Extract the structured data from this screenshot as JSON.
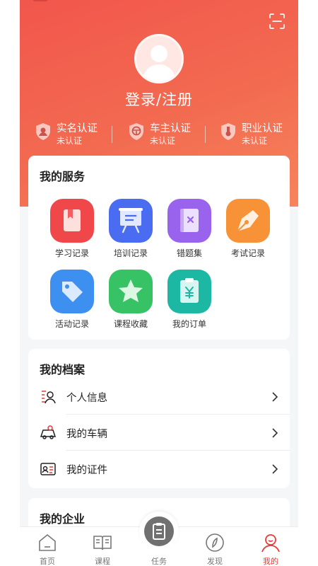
{
  "profile": {
    "login_label": "登录/注册"
  },
  "certs": [
    {
      "title": "实名认证",
      "status": "未认证",
      "icon": "user-badge-icon"
    },
    {
      "title": "车主认证",
      "status": "未认证",
      "icon": "car-shield-icon"
    },
    {
      "title": "职业认证",
      "status": "未认证",
      "icon": "medal-icon"
    }
  ],
  "services": {
    "title": "我的服务",
    "items": [
      {
        "label": "学习记录",
        "icon": "bookmark-icon",
        "color": "#f0484a"
      },
      {
        "label": "培训记录",
        "icon": "easel-icon",
        "color": "#4a6cf0"
      },
      {
        "label": "错题集",
        "icon": "wrong-book-icon",
        "color": "#9a63ee"
      },
      {
        "label": "考试记录",
        "icon": "pen-nib-icon",
        "color": "#f79236"
      },
      {
        "label": "活动记录",
        "icon": "tag-icon",
        "color": "#3d8ff0"
      },
      {
        "label": "课程收藏",
        "icon": "star-icon",
        "color": "#38c266"
      },
      {
        "label": "我的订单",
        "icon": "order-clipboard-icon",
        "color": "#1cb8a4"
      }
    ]
  },
  "archives": {
    "title": "我的档案",
    "items": [
      {
        "label": "个人信息",
        "icon": "personal-info-icon"
      },
      {
        "label": "我的车辆",
        "icon": "vehicle-icon"
      },
      {
        "label": "我的证件",
        "icon": "id-card-icon"
      }
    ]
  },
  "enterprise": {
    "title": "我的企业"
  },
  "tabs": [
    {
      "label": "首页",
      "icon": "home-icon",
      "active": false
    },
    {
      "label": "课程",
      "icon": "book-icon",
      "active": false
    },
    {
      "label": "任务",
      "icon": "task-clipboard-icon",
      "active": false
    },
    {
      "label": "发现",
      "icon": "compass-icon",
      "active": false
    },
    {
      "label": "我的",
      "icon": "profile-icon",
      "active": true
    }
  ],
  "colors": {
    "brand": "#f2564c",
    "active_tab": "#e83c37"
  }
}
